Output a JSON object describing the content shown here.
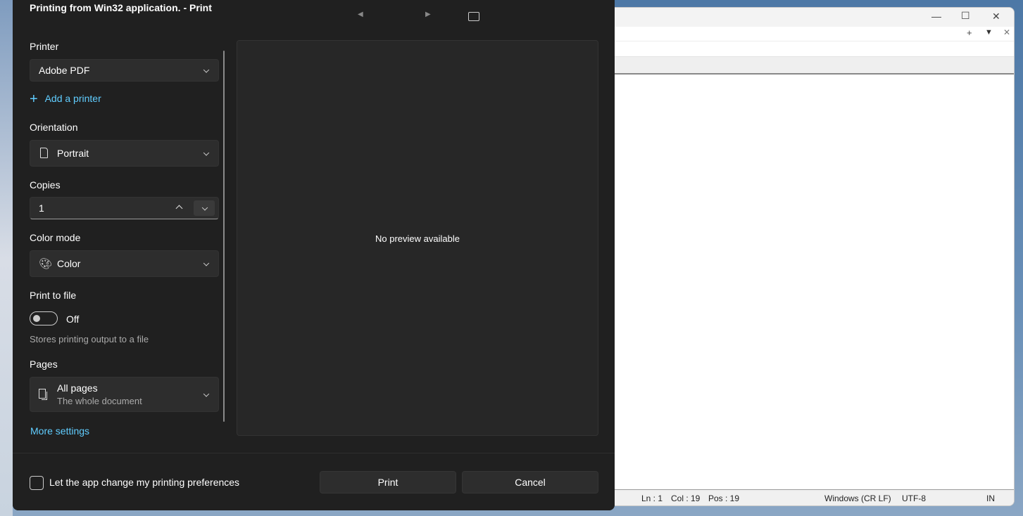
{
  "dialog": {
    "title": "Printing from Win32 application. - Print",
    "printer": {
      "label": "Printer",
      "value": "Adobe PDF",
      "add_label": "Add a printer"
    },
    "orientation": {
      "label": "Orientation",
      "value": "Portrait"
    },
    "copies": {
      "label": "Copies",
      "value": "1"
    },
    "color_mode": {
      "label": "Color mode",
      "value": "Color"
    },
    "print_to_file": {
      "label": "Print to file",
      "state": "Off",
      "description": "Stores printing output to a file"
    },
    "pages": {
      "label": "Pages",
      "value": "All pages",
      "sub": "The whole document"
    },
    "more_settings": "More settings",
    "preview_text": "No preview available",
    "checkbox_label": "Let the app change my printing preferences",
    "print_button": "Print",
    "cancel_button": "Cancel",
    "accent": "#60cdff"
  },
  "notepad": {
    "status": {
      "ln": "Ln : 1",
      "col": "Col : 19",
      "pos": "Pos : 19",
      "eol": "Windows (CR LF)",
      "encoding": "UTF-8",
      "mode": "IN"
    }
  }
}
